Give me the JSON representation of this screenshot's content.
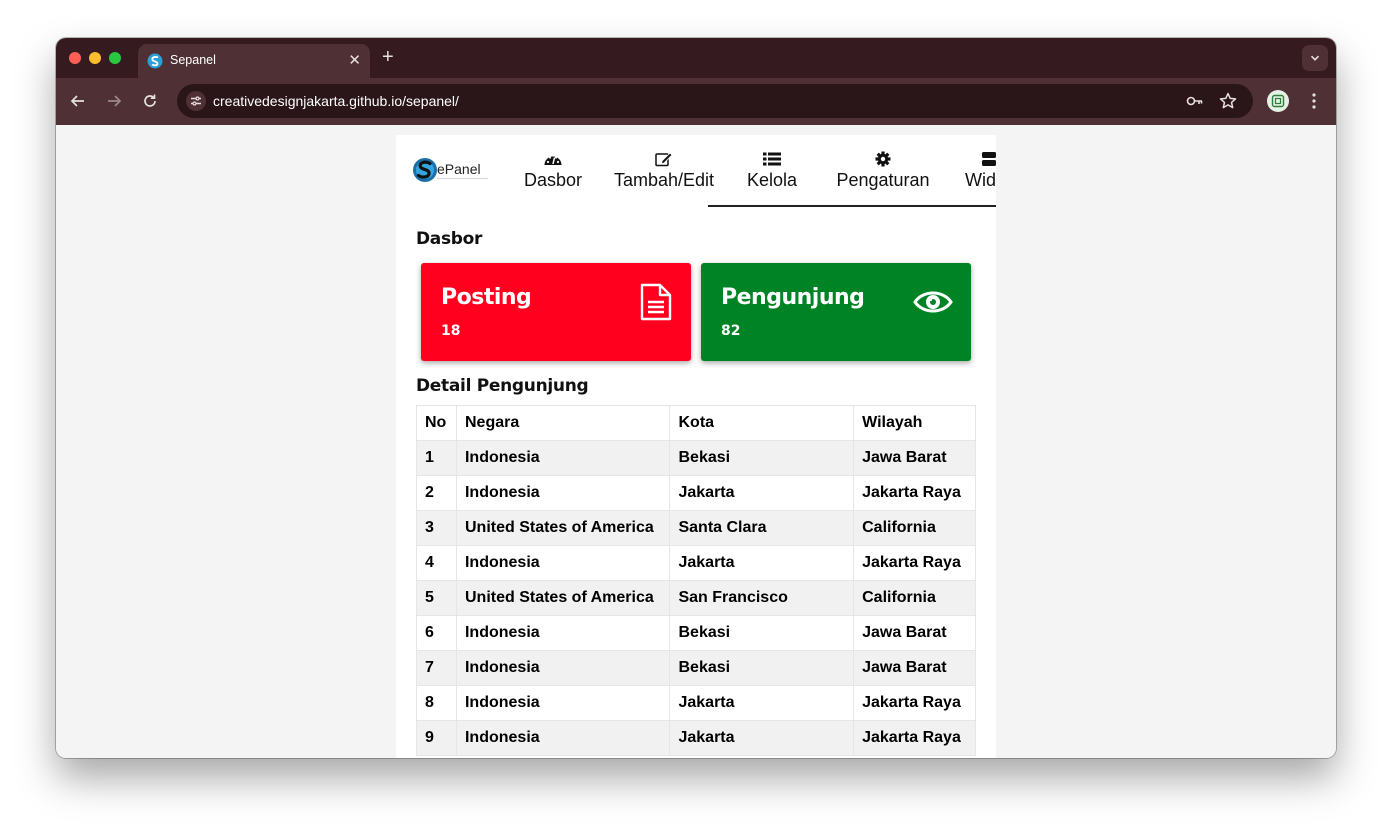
{
  "browser": {
    "tab_title": "Sepanel",
    "url": "creativedesignjakarta.github.io/sepanel/"
  },
  "app": {
    "logo_text": "SePanel",
    "nav": [
      {
        "label": "Dasbor",
        "icon": "dashboard-icon"
      },
      {
        "label": "Tambah/Edit",
        "icon": "edit-icon"
      },
      {
        "label": "Kelola",
        "icon": "list-icon"
      },
      {
        "label": "Pengaturan",
        "icon": "gear-icon"
      },
      {
        "label": "Widget",
        "icon": "widget-icon"
      }
    ],
    "page_heading": "Dasbor",
    "cards": [
      {
        "title": "Posting",
        "value": "18",
        "icon": "document-icon",
        "color": "#ff001e"
      },
      {
        "title": "Pengunjung",
        "value": "82",
        "icon": "eye-icon",
        "color": "#008324"
      }
    ],
    "detail_heading": "Detail Pengunjung",
    "table": {
      "columns": [
        "No",
        "Negara",
        "Kota",
        "Wilayah"
      ],
      "rows": [
        [
          "1",
          "Indonesia",
          "Bekasi",
          "Jawa Barat"
        ],
        [
          "2",
          "Indonesia",
          "Jakarta",
          "Jakarta Raya"
        ],
        [
          "3",
          "United States of America",
          "Santa Clara",
          "California"
        ],
        [
          "4",
          "Indonesia",
          "Jakarta",
          "Jakarta Raya"
        ],
        [
          "5",
          "United States of America",
          "San Francisco",
          "California"
        ],
        [
          "6",
          "Indonesia",
          "Bekasi",
          "Jawa Barat"
        ],
        [
          "7",
          "Indonesia",
          "Bekasi",
          "Jawa Barat"
        ],
        [
          "8",
          "Indonesia",
          "Jakarta",
          "Jakarta Raya"
        ],
        [
          "9",
          "Indonesia",
          "Jakarta",
          "Jakarta Raya"
        ]
      ]
    }
  }
}
